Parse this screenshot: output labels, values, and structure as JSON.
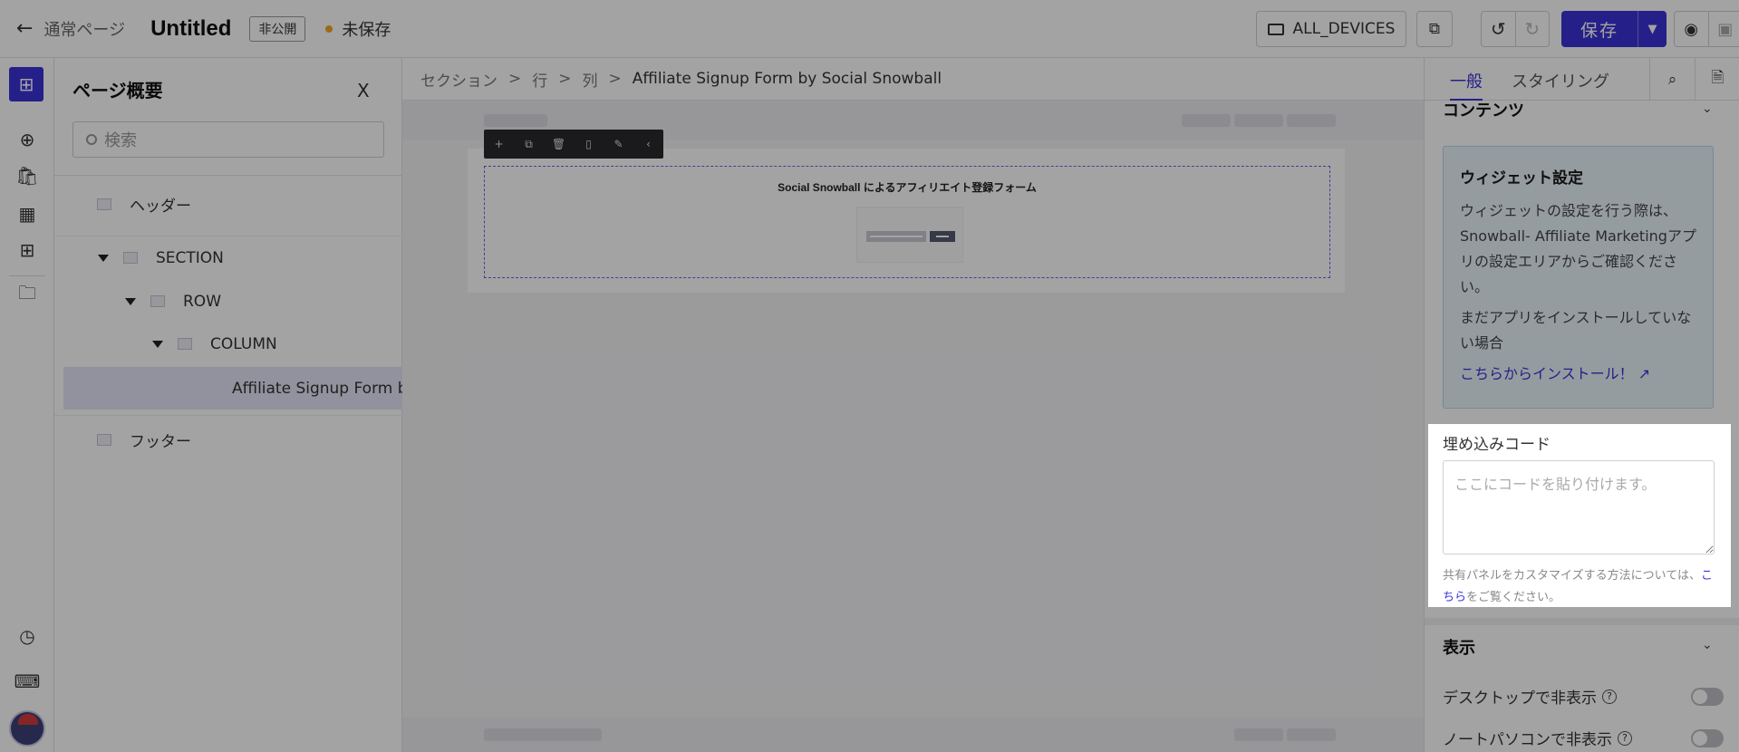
{
  "topbar": {
    "back_label": "通常ページ",
    "title": "Untitled",
    "visibility_badge": "非公開",
    "unsaved_label": "未保存",
    "devices_label": "ALL_DEVICES",
    "save_label": "保存"
  },
  "overview": {
    "title": "ページ概要",
    "close_label": "X",
    "search_placeholder": "検索",
    "tree": {
      "header": "ヘッダー",
      "section": "SECTION",
      "row": "ROW",
      "column": "COLUMN",
      "widget": "Affiliate Signup Form by",
      "footer": "フッター"
    }
  },
  "canvas": {
    "breadcrumb": [
      "セクション",
      "行",
      "列",
      "Affiliate Signup Form by Social Snowball"
    ],
    "widget_title": "Social Snowball によるアフィリエイト登録フォーム"
  },
  "right_panel": {
    "tabs": [
      "一般",
      "スタイリング"
    ],
    "content_heading": "コンテンツ",
    "info": {
      "heading": "ウィジェット設定",
      "para1": "ウィジェットの設定を行う際は、Snowball- Affiliate Marketingアプリの設定エリアからご確認ください。",
      "para2": "まだアプリをインストールしていない場合",
      "link": "こちらからインストール！"
    },
    "embed": {
      "label": "埋め込みコード",
      "placeholder": "ここにコードを貼り付けます。",
      "hint_before": "共有パネルをカスタマイズする方法については、",
      "hint_link": "こちら",
      "hint_after": "をご覧ください。"
    },
    "display_heading": "表示",
    "toggles": [
      "デスクトップで非表示",
      "ノートパソコンで非表示"
    ]
  },
  "colors": {
    "accent": "#3b33d6",
    "unsaved_dot": "#f5a623"
  }
}
